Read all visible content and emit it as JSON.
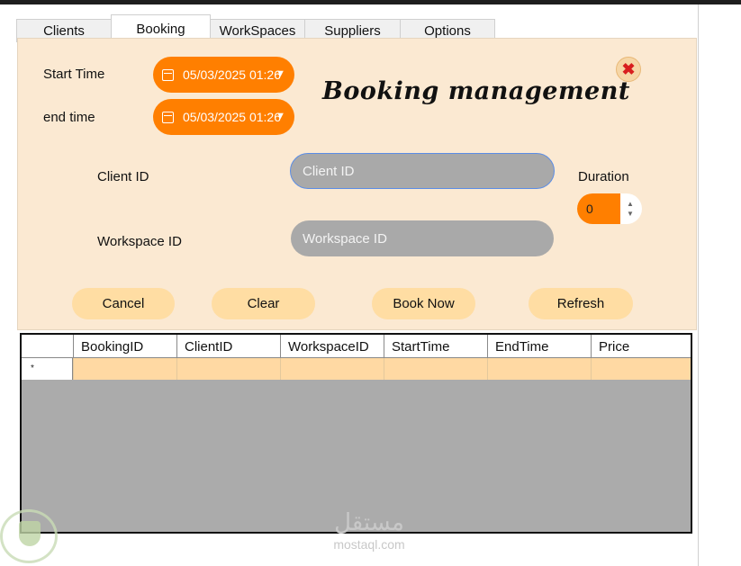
{
  "tabs": [
    "Clients",
    "Booking",
    "WorkSpaces",
    "Suppliers",
    "Options"
  ],
  "active_tab": "Booking",
  "form": {
    "title": "Booking management",
    "start_time_label": "Start Time",
    "end_time_label": "end time",
    "start_time_value": "05/03/2025 01:26",
    "end_time_value": "05/03/2025 01:26",
    "client_id_label": "Client ID",
    "client_id_placeholder": "Client ID",
    "workspace_id_label": "Workspace ID",
    "workspace_id_placeholder": "Workspace ID",
    "duration_label": "Duration",
    "duration_value": "0"
  },
  "buttons": {
    "cancel": "Cancel",
    "clear": "Clear",
    "book_now": "Book Now",
    "refresh": "Refresh"
  },
  "grid": {
    "columns": [
      "BookingID",
      "ClientID",
      "WorkspaceID",
      "StartTime",
      "EndTime",
      "Price"
    ],
    "new_row_marker": "*"
  },
  "watermark": {
    "arabic": "مستقل",
    "latin": "mostaql.com"
  },
  "colors": {
    "panel_bg": "#fbe9d2",
    "accent_orange": "#ff7f00",
    "button_bg": "#ffdda3",
    "input_bg": "#a9a9a9",
    "grid_bg": "#ababab",
    "row_highlight": "#ffd9a3",
    "close_red": "#d81e1e"
  },
  "icons": {
    "close": "close-icon",
    "calendar": "calendar-icon",
    "dropdown": "chevron-down-icon",
    "stepper": "stepper-arrows-icon",
    "logo": "shield-logo-icon"
  }
}
